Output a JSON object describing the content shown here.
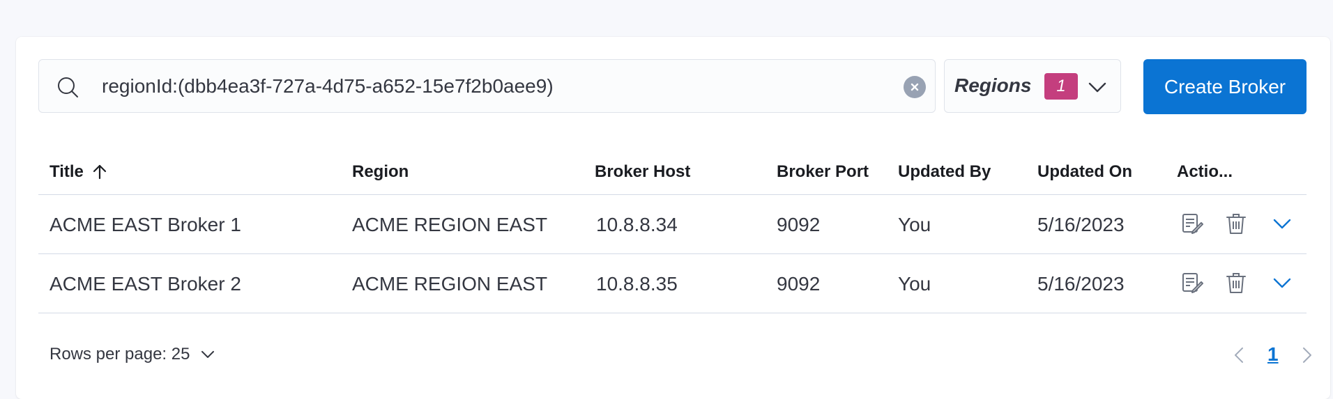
{
  "search": {
    "value": "regionId:(dbb4ea3f-727a-4d75-a652-15e7f2b0aee9)",
    "icon": "search-icon",
    "clear_icon": "clear-icon"
  },
  "regions_filter": {
    "label": "Regions",
    "count": "1",
    "icon": "chevron-down-icon",
    "badge_color": "#c43e7e"
  },
  "create_button": {
    "label": "Create Broker",
    "color": "#0b74d3"
  },
  "table": {
    "columns": [
      {
        "label": "Title",
        "sort": "ascending"
      },
      {
        "label": "Region"
      },
      {
        "label": "Broker Host"
      },
      {
        "label": "Broker Port"
      },
      {
        "label": "Updated By"
      },
      {
        "label": "Updated On"
      },
      {
        "label": "Actio..."
      }
    ],
    "rows": [
      {
        "title": "ACME EAST Broker 1",
        "region": "ACME REGION EAST",
        "host": "10.8.8.34",
        "port": "9092",
        "updated_by": "You",
        "updated_on": "5/16/2023"
      },
      {
        "title": "ACME EAST Broker 2",
        "region": "ACME REGION EAST",
        "host": "10.8.8.35",
        "port": "9092",
        "updated_by": "You",
        "updated_on": "5/16/2023"
      }
    ],
    "row_actions": [
      "edit-icon",
      "delete-icon",
      "chevron-down-icon"
    ]
  },
  "footer": {
    "rows_per_page": "Rows per page: 25",
    "current_page": "1"
  }
}
